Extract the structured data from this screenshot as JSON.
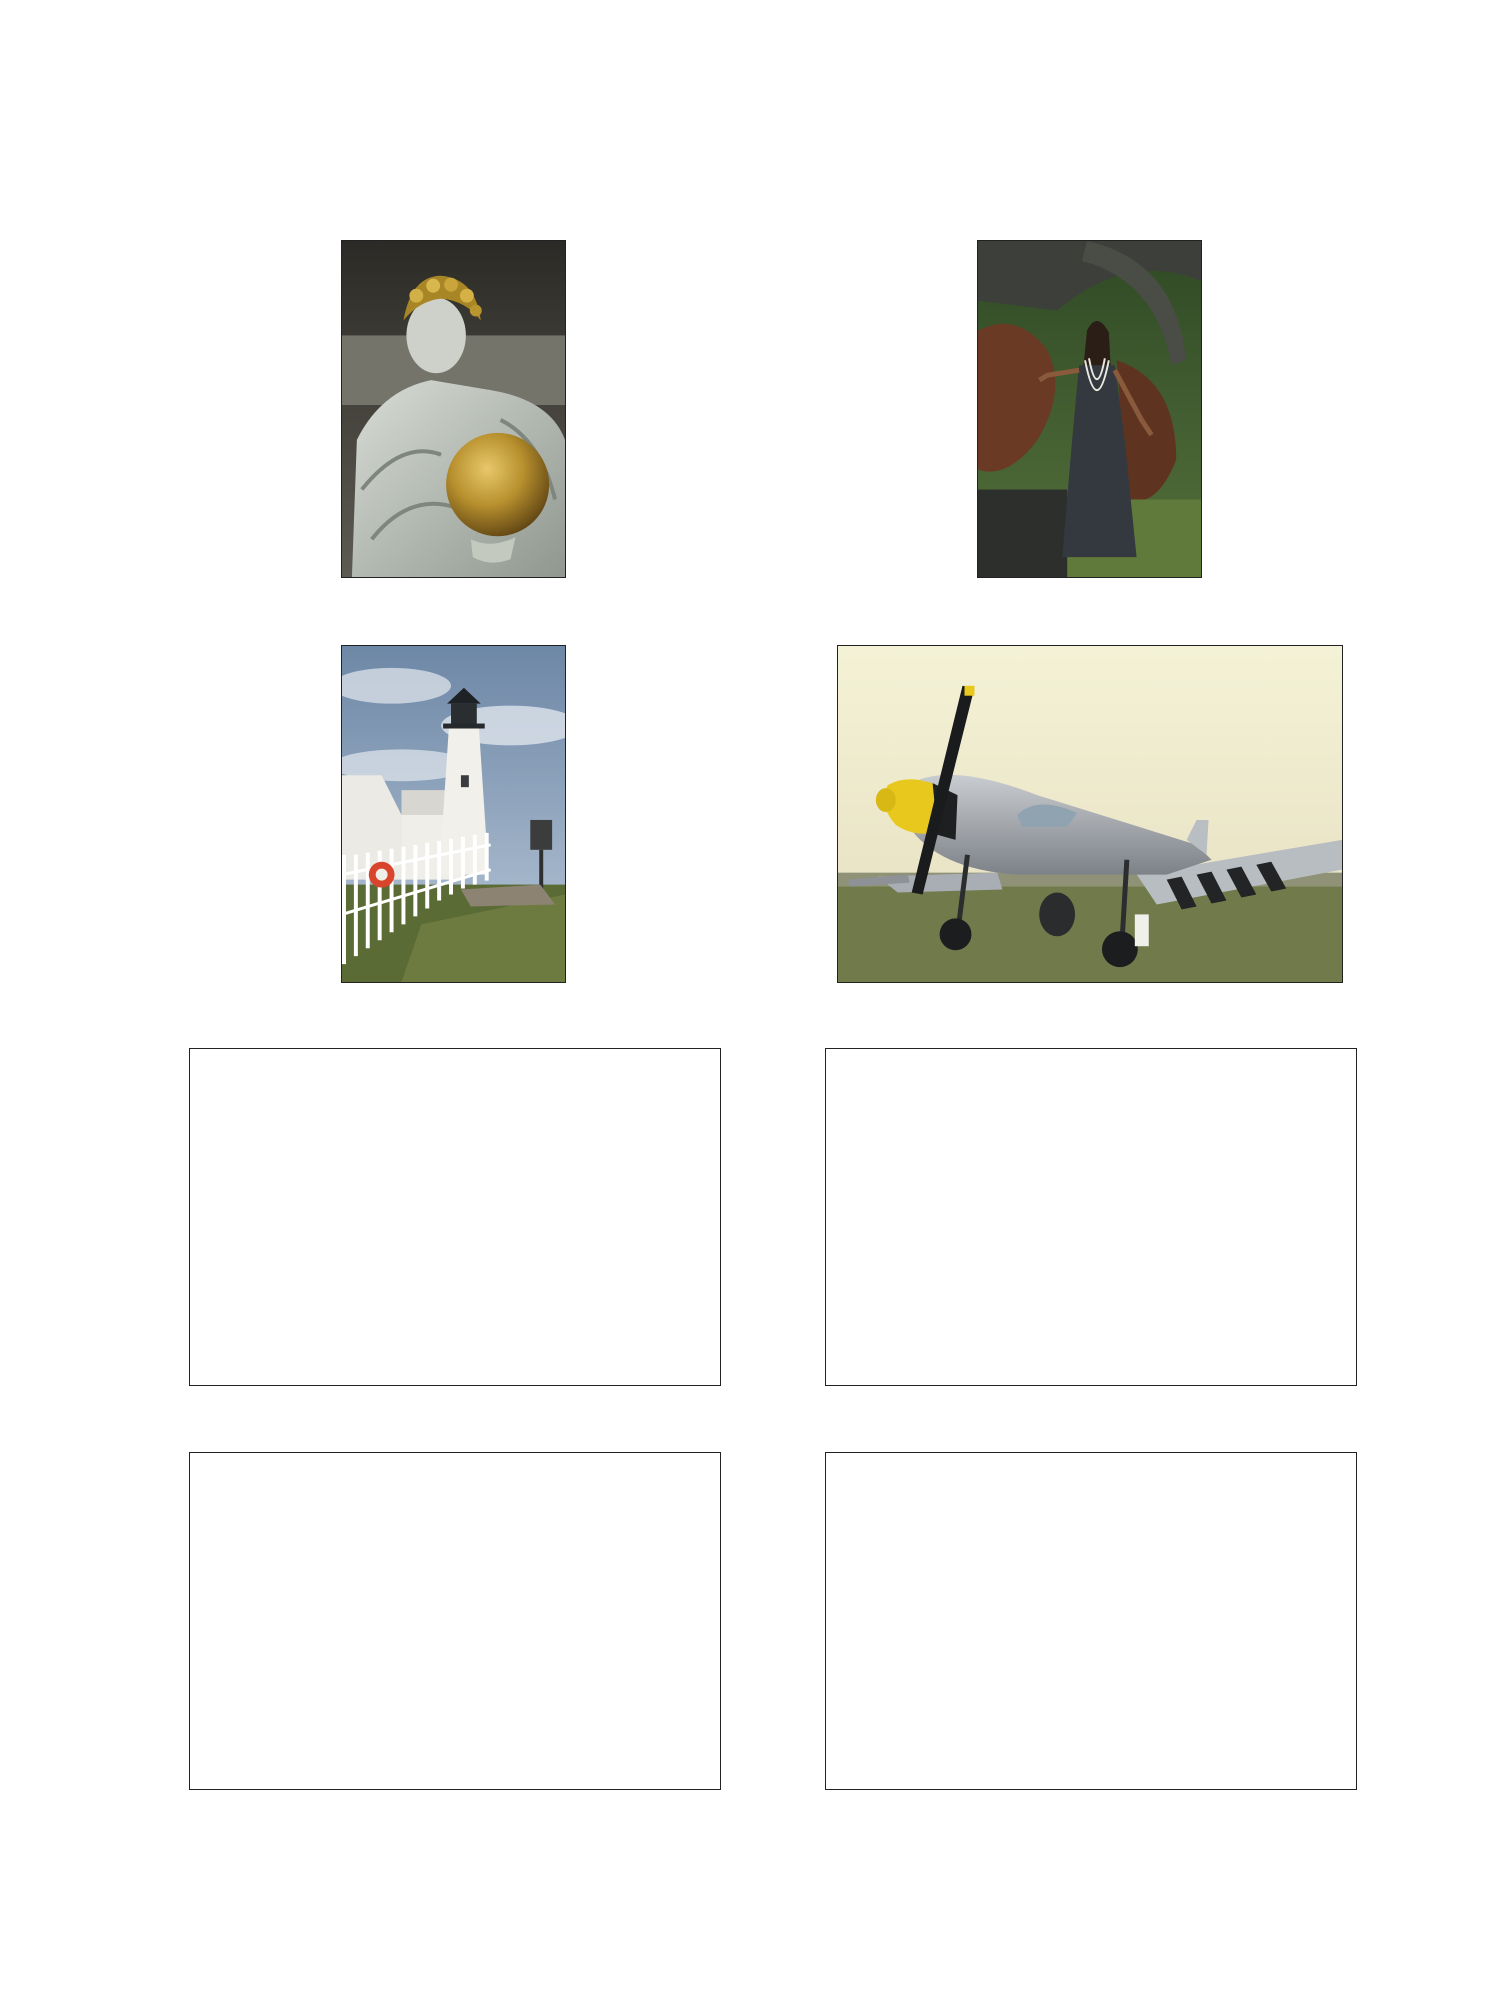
{
  "photos": [
    {
      "subject": "statue-with-golden-globe"
    },
    {
      "subject": "woman-in-dark-dress"
    },
    {
      "subject": "lighthouse"
    },
    {
      "subject": "p51-mustang-airplane"
    }
  ],
  "empty_frames": 4
}
